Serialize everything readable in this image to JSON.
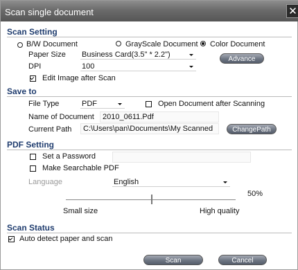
{
  "window": {
    "title": "Scan single document",
    "close_glyph": "✕"
  },
  "scan_setting": {
    "heading": "Scan Setting",
    "modes": [
      {
        "label": "B/W Document",
        "selected": false
      },
      {
        "label": "GrayScale Document",
        "selected": false
      },
      {
        "label": "Color Document",
        "selected": true
      }
    ],
    "paper_size_label": "Paper Size",
    "paper_size_value": "Business Card(3.5\" * 2.2\")",
    "advance_button": "Advance",
    "dpi_label": "DPI",
    "dpi_value": "100",
    "edit_image_label": "Edit Image after Scan",
    "edit_image_checked": true
  },
  "save_to": {
    "heading": "Save to",
    "file_type_label": "File Type",
    "file_type_value": "PDF",
    "open_after_label": "Open Document after Scanning",
    "open_after_checked": false,
    "doc_name_label": "Name of Document",
    "doc_name_value": "2010_0611.Pdf",
    "current_path_label": "Current Path",
    "current_path_value": "C:\\Users\\pan\\Documents\\My Scanned Docs",
    "change_path_button": "ChangePath"
  },
  "pdf_setting": {
    "heading": "PDF Setting",
    "password_label": "Set a Password",
    "password_checked": false,
    "password_value": "",
    "searchable_label": "Make Searchable PDF",
    "searchable_checked": false,
    "language_label": "Language",
    "language_value": "English",
    "quality_percent": "50%",
    "quality_level": 0.5,
    "small_size_label": "Small size",
    "high_quality_label": "High quality"
  },
  "scan_status": {
    "heading": "Scan Status",
    "auto_detect_label": "Auto detect paper and scan",
    "auto_detect_checked": true
  },
  "footer": {
    "scan_button": "Scan",
    "cancel_button": "Cancel"
  },
  "colors": {
    "titlebar": "#6b6b6b",
    "section_heading": "#1f3c6e",
    "button": "#6d7582"
  }
}
